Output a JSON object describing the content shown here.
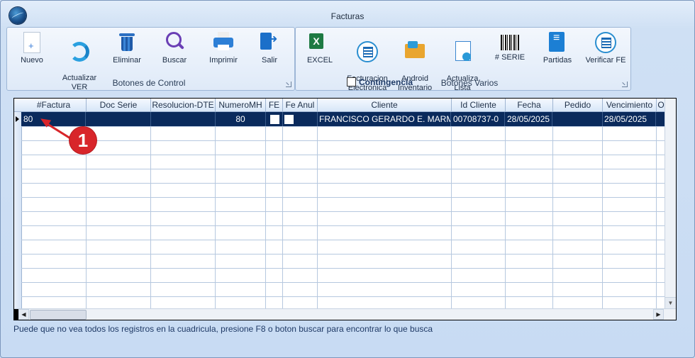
{
  "window": {
    "title": "Facturas"
  },
  "toolbar_control": {
    "label": "Botones de Control",
    "buttons": [
      {
        "label": "Nuevo",
        "icon": "new-document-icon"
      },
      {
        "label": "Actualizar\nVER",
        "icon": "refresh-icon"
      },
      {
        "label": "Eliminar",
        "icon": "trash-icon"
      },
      {
        "label": "Buscar",
        "icon": "search-icon"
      },
      {
        "label": "Imprimir",
        "icon": "printer-icon"
      },
      {
        "label": "Salir",
        "icon": "exit-icon"
      }
    ]
  },
  "toolbar_varios": {
    "label": "Botones Varios",
    "contingencia": "Contingencia",
    "buttons": [
      {
        "label": "EXCEL",
        "icon": "excel-icon"
      },
      {
        "label": "Facturacion\nElectronica",
        "icon": "e-invoice-icon"
      },
      {
        "label": "Android\nInventario",
        "icon": "android-inventory-icon"
      },
      {
        "label": "Actualiza\nLista",
        "icon": "update-list-icon"
      },
      {
        "label": "# SERIE",
        "icon": "barcode-icon"
      },
      {
        "label": "Partidas",
        "icon": "ledger-icon"
      },
      {
        "label": "Verificar FE",
        "icon": "verify-e-invoice-icon"
      }
    ]
  },
  "grid": {
    "columns": [
      "#Factura",
      "Doc Serie",
      "Resolucion-DTE",
      "NumeroMH",
      "FE",
      "Fe Anul",
      "Cliente",
      "Id Cliente",
      "Fecha",
      "Pedido",
      "Vencimiento",
      "O"
    ],
    "rows": [
      {
        "factura": "80",
        "doc_serie": "",
        "resolucion": "",
        "numero_mh": "80",
        "fe": false,
        "fe_anul": false,
        "cliente": "FRANCISCO GERARDO E. MARMOL",
        "id_cliente": "00708737-0",
        "fecha": "28/05/2025",
        "pedido": "",
        "vencimiento": "28/05/2025"
      }
    ]
  },
  "status_text": "Puede que no vea todos los registros en la cuadricula, presione F8 o boton buscar para encontrar lo que busca",
  "annotation": {
    "number": "1",
    "color": "#d8252a"
  }
}
